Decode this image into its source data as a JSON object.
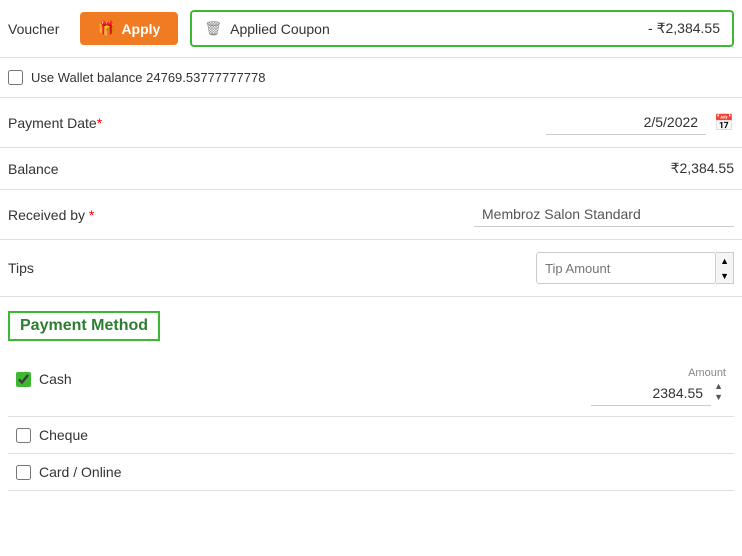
{
  "top": {
    "voucher_label": "Voucher",
    "apply_button": "Apply",
    "apply_icon": "🎁",
    "trash_icon": "🗑",
    "applied_coupon_text": "Applied Coupon",
    "applied_coupon_amount": "- ₹2,384.55"
  },
  "wallet": {
    "label": "Use Wallet balance 24769.53777777778"
  },
  "payment_date": {
    "label": "Payment Date",
    "value": "2/5/2022"
  },
  "balance": {
    "label": "Balance",
    "value": "₹2,384.55"
  },
  "received_by": {
    "label": "Received by",
    "value": "Membroz Salon Standard"
  },
  "tips": {
    "label": "Tips",
    "placeholder": "Tip Amount"
  },
  "payment_method": {
    "heading": "Payment Method"
  },
  "options": {
    "cash": {
      "label": "Cash",
      "checked": true,
      "amount_label": "Amount",
      "amount_value": "2384.55"
    },
    "cheque": {
      "label": "Cheque",
      "checked": false
    },
    "card_online": {
      "label": "Card / Online",
      "checked": false
    }
  }
}
